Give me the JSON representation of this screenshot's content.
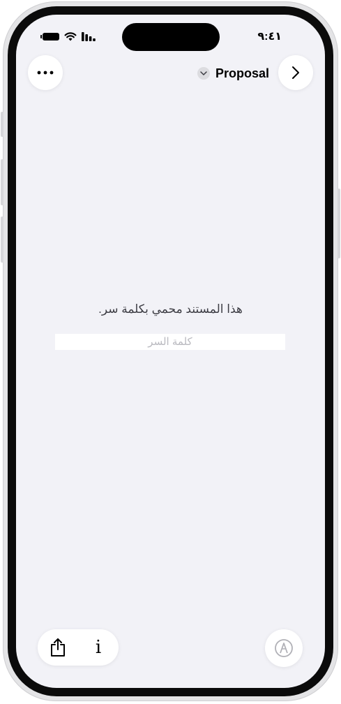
{
  "status_bar": {
    "time": "٩:٤١",
    "icons": [
      "battery-icon",
      "wifi-icon",
      "cellular-signal-icon"
    ]
  },
  "toolbar": {
    "more_icon": "ellipsis-icon",
    "document_title": "Proposal",
    "title_menu_icon": "chevron-down-icon",
    "navigate_icon": "chevron-right-icon"
  },
  "lock_screen": {
    "message": "هذا المستند محمي بكلمة سر.",
    "password_placeholder": "كلمة السر",
    "password_value": ""
  },
  "bottom_bar": {
    "share_icon": "share-icon",
    "info_label": "i",
    "info_icon": "info-icon",
    "markup_icon": "markup-pen-icon"
  },
  "colors": {
    "screen_background": "#f2f2f7",
    "button_background": "#ffffff",
    "text_primary": "#000000",
    "text_secondary": "#3c3c43",
    "placeholder": "#b9b9bf",
    "disabled_icon": "#b0b0b6"
  }
}
